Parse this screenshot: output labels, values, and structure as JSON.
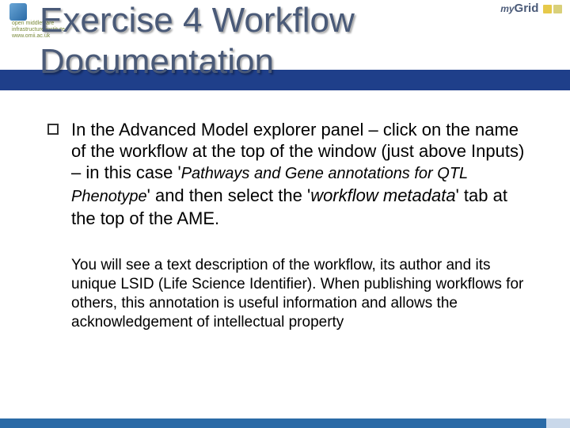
{
  "logo_omii": {
    "line1": "open middleware",
    "line2": "infrastructure institute",
    "line3": "www.omii.ac.uk"
  },
  "logo_mygrid": {
    "my": "my",
    "grid": "Grid"
  },
  "title": "Exercise 4 Workflow Documentation",
  "para1": {
    "t1": "In the Advanced Model explorer panel – click on the name of the workflow at the top of the window (just above Inputs) – in this case '",
    "it1": "Pathways and Gene annotations for QTL Phenotype",
    "t2": "' and then select the '",
    "it2": "workflow metadata",
    "t3": "' tab at the top of the AME."
  },
  "para2": "You will see a text description of the workflow, its author and its unique LSID (Life Science Identifier). When publishing workflows for others, this annotation is useful information and allows the acknowledgement of intellectual property"
}
